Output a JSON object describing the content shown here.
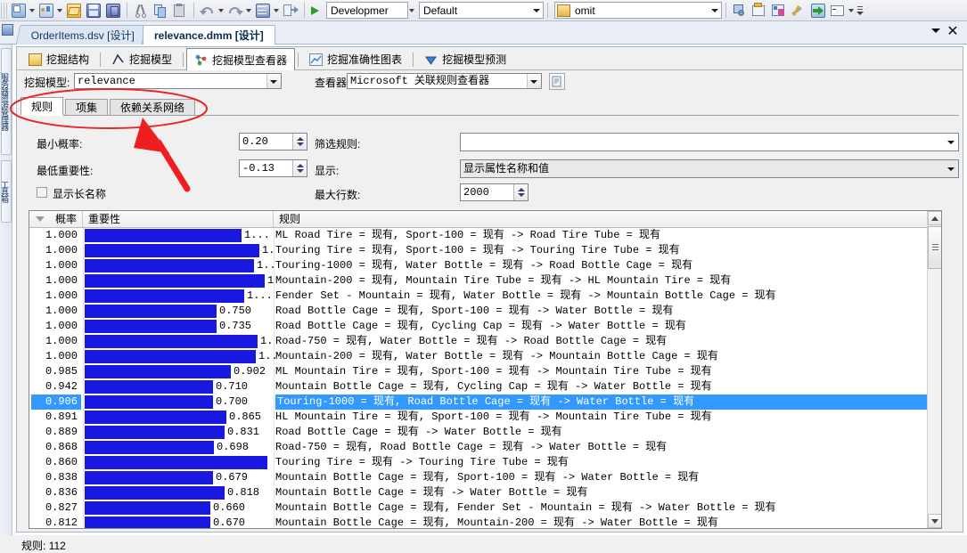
{
  "toolbar": {
    "icons": [
      "new-project-icon",
      "new-item-icon",
      "open-file-icon",
      "save-icon",
      "save-all-icon",
      "cut-icon",
      "copy-icon",
      "paste-icon",
      "undo-icon",
      "redo-icon",
      "navigate-icon",
      "show-all-files-icon"
    ],
    "config_value": "Developmer",
    "platform_value": "Default",
    "solution_value": "omit",
    "right_icons": [
      "find-in-files-icon",
      "properties-window-icon",
      "toolbox-icon",
      "options-icon",
      "deploy-icon",
      "command-window-icon"
    ]
  },
  "doc_tabs": {
    "inactive_label": "OrderItems.dsv [设计]",
    "active_label": "relevance.dmm [设计]",
    "close_glyph": "✕"
  },
  "left_dock": {
    "items": [
      "服务器资源管理器",
      "工具箱"
    ]
  },
  "view_tabs": [
    {
      "label": "挖掘结构",
      "icon": "mining-structure-icon",
      "selected": false
    },
    {
      "label": "挖掘模型",
      "icon": "mining-model-icon",
      "selected": false
    },
    {
      "label": "挖掘模型查看器",
      "icon": "mining-model-viewer-icon",
      "selected": true
    },
    {
      "label": "挖掘准确性图表",
      "icon": "accuracy-chart-icon",
      "selected": false
    },
    {
      "label": "挖掘模型预测",
      "icon": "prediction-icon",
      "selected": false
    }
  ],
  "selector": {
    "model_label": "挖掘模型:",
    "model_value": "relevance",
    "viewer_label": "查看器:",
    "viewer_value": "Microsoft 关联规则查看器",
    "refresh_icon": "refresh-icon"
  },
  "inner_tabs": [
    {
      "label": "规则",
      "selected": true
    },
    {
      "label": "项集",
      "selected": false
    },
    {
      "label": "依赖关系网络",
      "selected": false
    }
  ],
  "filters": {
    "min_prob_label": "最小概率:",
    "min_prob_value": "0.20",
    "min_import_label": "最低重要性:",
    "min_import_value": "-0.13",
    "show_long_names_label": "显示长名称",
    "show_long_names_checked": false,
    "filter_rule_label": "筛选规则:",
    "filter_rule_value": "",
    "show_label": "显示:",
    "show_value": "显示属性名称和值",
    "max_rows_label": "最大行数:",
    "max_rows_value": "2000"
  },
  "grid": {
    "columns": [
      "概率",
      "重要性",
      "规则"
    ],
    "sort_icon": "sort-descending-icon",
    "rows": [
      {
        "probability": "1.000",
        "importance_bar": 0.86,
        "importance_label": "1...",
        "rule": "ML Road Tire = 现有, Sport-100 = 现有 -> Road Tire Tube = 现有",
        "selected": false
      },
      {
        "probability": "1.000",
        "importance_bar": 0.955,
        "importance_label": "1.",
        "rule": "Touring Tire = 现有, Sport-100 = 现有 -> Touring Tire Tube = 现有",
        "selected": false
      },
      {
        "probability": "1.000",
        "importance_bar": 0.925,
        "importance_label": "1..",
        "rule": "Touring-1000 = 现有, Water Bottle = 现有 -> Road Bottle Cage = 现有",
        "selected": false
      },
      {
        "probability": "1.000",
        "importance_bar": 0.985,
        "importance_label": "1",
        "rule": "Mountain-200 = 现有, Mountain Tire Tube = 现有 -> HL Mountain Tire = 现有",
        "selected": false
      },
      {
        "probability": "1.000",
        "importance_bar": 0.875,
        "importance_label": "1...",
        "rule": "Fender Set - Mountain = 现有, Water Bottle = 现有 -> Mountain Bottle Cage = 现有",
        "selected": false
      },
      {
        "probability": "1.000",
        "importance_bar": 0.723,
        "importance_label": "0.750",
        "rule": "Road Bottle Cage = 现有, Sport-100 = 现有 -> Water Bottle = 现有",
        "selected": false
      },
      {
        "probability": "1.000",
        "importance_bar": 0.723,
        "importance_label": "0.735",
        "rule": "Road Bottle Cage = 现有, Cycling Cap = 现有 -> Water Bottle = 现有",
        "selected": false
      },
      {
        "probability": "1.000",
        "importance_bar": 0.945,
        "importance_label": "1.",
        "rule": "Road-750 = 现有, Water Bottle = 现有 -> Road Bottle Cage = 现有",
        "selected": false
      },
      {
        "probability": "1.000",
        "importance_bar": 0.935,
        "importance_label": "1..",
        "rule": "Mountain-200 = 现有, Water Bottle = 现有 -> Mountain Bottle Cage = 现有",
        "selected": false
      },
      {
        "probability": "0.985",
        "importance_bar": 0.8,
        "importance_label": "0.902",
        "rule": "ML Mountain Tire = 现有, Sport-100 = 现有 -> Mountain Tire Tube = 现有",
        "selected": false
      },
      {
        "probability": "0.942",
        "importance_bar": 0.7,
        "importance_label": "0.710",
        "rule": "Mountain Bottle Cage = 现有, Cycling Cap = 现有 -> Water Bottle = 现有",
        "selected": false
      },
      {
        "probability": "0.906",
        "importance_bar": 0.7,
        "importance_label": "0.700",
        "rule": "Touring-1000 = 现有, Road Bottle Cage = 现有 -> Water Bottle = 现有",
        "selected": true
      },
      {
        "probability": "0.891",
        "importance_bar": 0.775,
        "importance_label": "0.865",
        "rule": "HL Mountain Tire = 现有, Sport-100 = 现有 -> Mountain Tire Tube = 现有",
        "selected": false
      },
      {
        "probability": "0.889",
        "importance_bar": 0.765,
        "importance_label": "0.831",
        "rule": "Road Bottle Cage = 现有 -> Water Bottle = 现有",
        "selected": false
      },
      {
        "probability": "0.868",
        "importance_bar": 0.705,
        "importance_label": "0.698",
        "rule": "Road-750 = 现有, Road Bottle Cage = 现有 -> Water Bottle = 现有",
        "selected": false
      },
      {
        "probability": "0.860",
        "importance_bar": 1.0,
        "importance_label": "",
        "rule": "Touring Tire = 现有 -> Touring Tire Tube = 现有",
        "selected": false
      },
      {
        "probability": "0.838",
        "importance_bar": 0.7,
        "importance_label": "0.679",
        "rule": "Mountain Bottle Cage = 现有, Sport-100 = 现有 -> Water Bottle = 现有",
        "selected": false
      },
      {
        "probability": "0.836",
        "importance_bar": 0.765,
        "importance_label": "0.818",
        "rule": "Mountain Bottle Cage = 现有 -> Water Bottle = 现有",
        "selected": false
      },
      {
        "probability": "0.827",
        "importance_bar": 0.688,
        "importance_label": "0.660",
        "rule": "Mountain Bottle Cage = 现有, Fender Set - Mountain = 现有 -> Water Bottle = 现有",
        "selected": false
      },
      {
        "probability": "0.812",
        "importance_bar": 0.69,
        "importance_label": "0.670",
        "rule": "Mountain Bottle Cage = 现有, Mountain-200 = 现有 -> Water Bottle = 现有",
        "selected": false
      }
    ]
  },
  "status": {
    "rules_label": "规则:",
    "rules_count": "112"
  },
  "colors": {
    "bar": "#1818e0",
    "selection": "#3399ff",
    "annotation": "#e8262a"
  }
}
